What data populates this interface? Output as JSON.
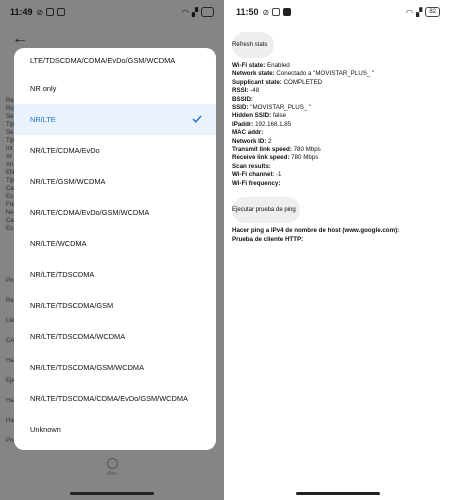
{
  "left": {
    "status": {
      "time": "11:49"
    },
    "background_labels": [
      "Re",
      "Ro",
      "Se",
      "Tip",
      "Se",
      "Tip",
      "Int",
      "Ar",
      "An",
      "EN",
      "Tip",
      "Ca",
      "Es",
      "Fre",
      "Ne",
      "Ca",
      "Es"
    ],
    "background_lower": [
      "Po",
      "Re",
      "Lte",
      "CA",
      "Ha",
      "Eje",
      "Ha",
      "Ha",
      "Pru"
    ],
    "options": [
      "LTE/TDSCDMA/CDMA/EvDo/GSM/WCDMA",
      "NR only",
      "NR/LTE",
      "NR/LTE/CDMA/EvDo",
      "NR/LTE/GSM/WCDMA",
      "NR/LTE/CDMA/EvDo/GSM/WCDMA",
      "NR/LTE/WCDMA",
      "NR/LTE/TDSCDMA",
      "NR/LTE/TDSCDMA/GSM",
      "NR/LTE/TDSCDMA/WCDMA",
      "NR/LTE/TDSCDMA/GSM/WCDMA",
      "NR/LTE/TDSCDMA/CDMA/EvDo/GSM/WCDMA",
      "Unknown"
    ],
    "selected_index": 2,
    "more_label": "Más",
    "accent": "#1a73d1"
  },
  "right": {
    "status": {
      "time": "11:50",
      "battery": "82"
    },
    "refresh_label": "Refresh stats",
    "info": [
      {
        "label": "Wi-Fi state:",
        "value": "Enabled"
      },
      {
        "label": "Network state:",
        "value": "Conectado a \"MOVISTAR_PLUS_       \""
      },
      {
        "label": "Supplicant state:",
        "value": "COMPLETED"
      },
      {
        "label": "RSSI:",
        "value": "-48"
      },
      {
        "label": "BSSID:",
        "value": ""
      },
      {
        "label": "SSID:",
        "value": "\"MOVISTAR_PLUS_        \""
      },
      {
        "label": "Hidden SSID:",
        "value": "false"
      },
      {
        "label": "IPaddr:",
        "value": "192.168.1.85"
      },
      {
        "label": "MAC addr:",
        "value": ""
      },
      {
        "label": "Network ID:",
        "value": "2"
      },
      {
        "label": "Transmit link speed:",
        "value": "780 Mbps"
      },
      {
        "label": "Receive link speed:",
        "value": "780 Mbps"
      },
      {
        "label": "Scan results:",
        "value": ""
      },
      {
        "label": "Wi-Fi channel:",
        "value": "-1"
      },
      {
        "label": "Wi-Fi frequency:",
        "value": ""
      }
    ],
    "ping_button": "Ejecutar prueba de ping",
    "ping_host": "Hacer ping a IPv4 de nombre de host (www.google.com):",
    "http_test": "Prueba de cliente HTTP:"
  }
}
